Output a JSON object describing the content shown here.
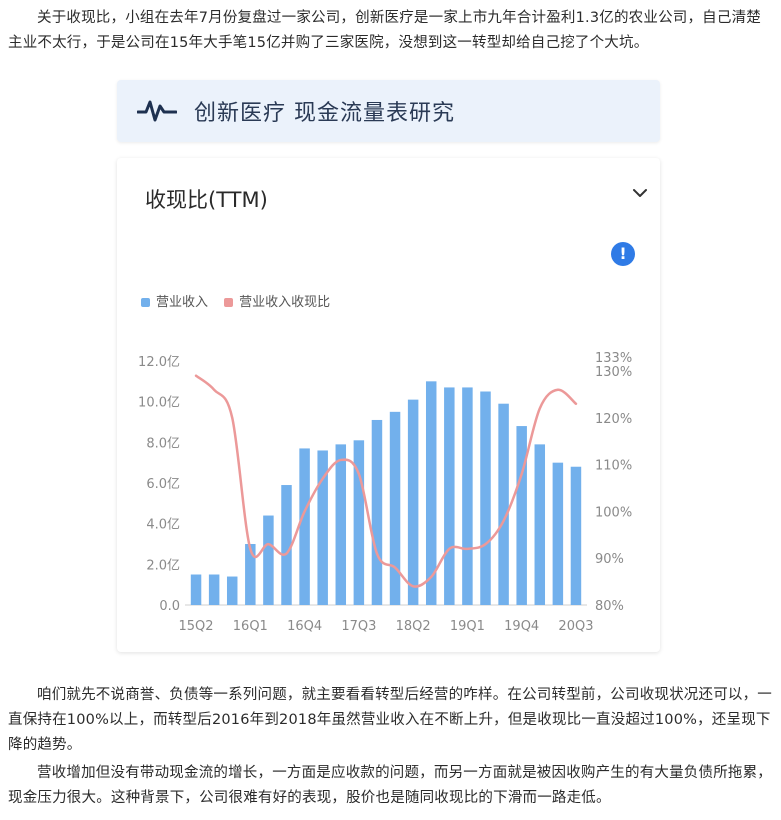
{
  "article": {
    "p1": "关于收现比，小组在去年7月份复盘过一家公司，创新医疗是一家上市九年合计盈利1.3亿的农业公司，自己清楚主业不太行，于是公司在15年大手笔15亿并购了三家医院，没想到这一转型却给自己挖了个大坑。",
    "p2": "咱们就先不说商誉、负债等一系列问题，就主要看看转型后经营的咋样。在公司转型前，公司收现状况还可以，一直保持在100%以上，而转型后2016年到2018年虽然营业收入在不断上升，但是收现比一直没超过100%，还呈现下降的趋势。",
    "p3": "营收增加但没有带动现金流的增长，一方面是应收款的问题，而另一方面就是被因收购产生的有大量负债所拖累，现金压力很大。这种背景下，公司很难有好的表现，股价也是随同收现比的下滑而一路走低。"
  },
  "header": {
    "title": "创新医疗 现金流量表研究",
    "icon": "pulse-wave-icon"
  },
  "card": {
    "metric_label": "收现比(TTM)",
    "dropdown_icon": "chevron-down-icon",
    "info_icon": "exclamation-circle-icon",
    "info_glyph": "!"
  },
  "colors": {
    "bar": "#72b0ec",
    "line": "#ec9999",
    "accent": "#2f7be6",
    "header_bg": "#ebf2fb"
  },
  "chart_data": {
    "type": "bar+line",
    "legend": [
      "营业收入",
      "营业收入收现比"
    ],
    "legend_position": "top-left",
    "categories": [
      "15Q2",
      "15Q3",
      "15Q4",
      "16Q1",
      "16Q2",
      "16Q3",
      "16Q4",
      "17Q1",
      "17Q2",
      "17Q3",
      "17Q4",
      "18Q1",
      "18Q2",
      "18Q3",
      "18Q4",
      "19Q1",
      "19Q2",
      "19Q3",
      "19Q4",
      "20Q1",
      "20Q2",
      "20Q3"
    ],
    "x_tick_labels": [
      "15Q2",
      "16Q1",
      "16Q4",
      "17Q3",
      "18Q2",
      "19Q1",
      "19Q4",
      "20Q3"
    ],
    "series": [
      {
        "name": "营业收入",
        "type": "bar",
        "axis": "left",
        "values": [
          1.5,
          1.5,
          1.4,
          3.0,
          4.4,
          5.9,
          7.7,
          7.6,
          7.9,
          8.1,
          9.1,
          9.5,
          10.1,
          11.0,
          10.7,
          10.7,
          10.5,
          9.9,
          8.8,
          7.9,
          7.0,
          6.8
        ]
      },
      {
        "name": "营业收入收现比",
        "type": "line",
        "axis": "right",
        "values": [
          129,
          126,
          120,
          92,
          93,
          91,
          100,
          107,
          111,
          108,
          91,
          88,
          84,
          86,
          92,
          92,
          93,
          98,
          108,
          122,
          126,
          123
        ]
      }
    ],
    "y_left": {
      "ticks": [
        "0.0",
        "2.0亿",
        "4.0亿",
        "6.0亿",
        "8.0亿",
        "10.0亿",
        "12.0亿"
      ],
      "range": [
        0,
        12
      ]
    },
    "y_right": {
      "ticks": [
        "80%",
        "90%",
        "100%",
        "110%",
        "120%",
        "130%",
        "133%"
      ],
      "range": [
        80,
        133
      ]
    },
    "grid": false
  }
}
